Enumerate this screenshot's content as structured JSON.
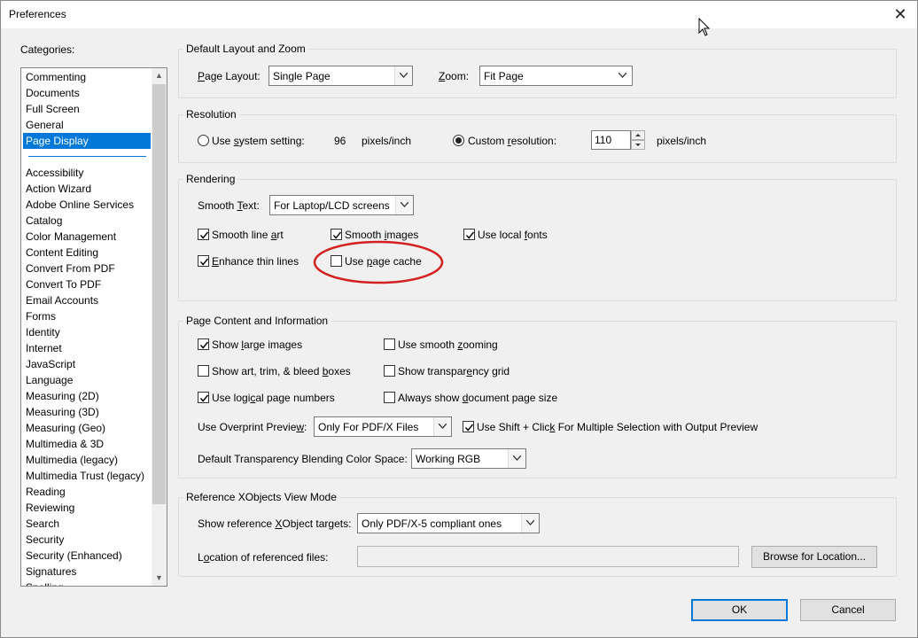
{
  "window": {
    "title": "Preferences",
    "close_glyph": "✕"
  },
  "categories": {
    "label": "Categories:",
    "top_items": [
      {
        "label": "Commenting"
      },
      {
        "label": "Documents"
      },
      {
        "label": "Full Screen"
      },
      {
        "label": "General"
      },
      {
        "label": "Page Display",
        "selected": true
      }
    ],
    "items": [
      {
        "label": "Accessibility"
      },
      {
        "label": "Action Wizard"
      },
      {
        "label": "Adobe Online Services"
      },
      {
        "label": "Catalog"
      },
      {
        "label": "Color Management"
      },
      {
        "label": "Content Editing"
      },
      {
        "label": "Convert From PDF"
      },
      {
        "label": "Convert To PDF"
      },
      {
        "label": "Email Accounts"
      },
      {
        "label": "Forms"
      },
      {
        "label": "Identity"
      },
      {
        "label": "Internet"
      },
      {
        "label": "JavaScript"
      },
      {
        "label": "Language"
      },
      {
        "label": "Measuring (2D)"
      },
      {
        "label": "Measuring (3D)"
      },
      {
        "label": "Measuring (Geo)"
      },
      {
        "label": "Multimedia & 3D"
      },
      {
        "label": "Multimedia (legacy)"
      },
      {
        "label": "Multimedia Trust (legacy)"
      },
      {
        "label": "Reading"
      },
      {
        "label": "Reviewing"
      },
      {
        "label": "Search"
      },
      {
        "label": "Security"
      },
      {
        "label": "Security (Enhanced)"
      },
      {
        "label": "Signatures"
      },
      {
        "label": "Spelling"
      }
    ]
  },
  "layout_zoom": {
    "title": "Default Layout and Zoom",
    "page_layout_label": "Page Layout:",
    "page_layout_value": "Single Page",
    "zoom_label": "Zoom:",
    "zoom_value": "Fit Page"
  },
  "resolution": {
    "title": "Resolution",
    "system_label": "Use system setting:",
    "system_value": "96",
    "system_unit": "pixels/inch",
    "custom_label": "Custom resolution:",
    "custom_value": "110",
    "custom_unit": "pixels/inch",
    "selected": "custom"
  },
  "rendering": {
    "title": "Rendering",
    "smooth_text_label": "Smooth Text:",
    "smooth_text_value": "For Laptop/LCD screens",
    "smooth_line_art": {
      "label": "Smooth line art",
      "checked": true
    },
    "smooth_images": {
      "label": "Smooth images",
      "checked": true
    },
    "use_local_fonts": {
      "label": "Use local fonts",
      "checked": true
    },
    "enhance_thin_lines": {
      "label": "Enhance thin lines",
      "checked": true
    },
    "use_page_cache": {
      "label": "Use page cache",
      "checked": false
    }
  },
  "page_content": {
    "title": "Page Content and Information",
    "show_large_images": {
      "label": "Show large images",
      "checked": true
    },
    "use_smooth_zooming": {
      "label": "Use smooth zooming",
      "checked": false
    },
    "show_art_trim": {
      "label": "Show art, trim, & bleed boxes",
      "checked": false
    },
    "show_transparency_grid": {
      "label": "Show transparency grid",
      "checked": false
    },
    "use_logical_page_numbers": {
      "label": "Use logical page numbers",
      "checked": true
    },
    "always_show_page_size": {
      "label": "Always show document page size",
      "checked": false
    },
    "overprint_label": "Use Overprint Preview:",
    "overprint_value": "Only For PDF/X Files",
    "shift_click": {
      "label": "Use Shift + Click For Multiple Selection with Output Preview",
      "checked": true
    },
    "blending_label": "Default Transparency Blending Color Space:",
    "blending_value": "Working RGB"
  },
  "xobjects": {
    "title": "Reference XObjects View Mode",
    "targets_label": "Show reference XObject targets:",
    "targets_value": "Only PDF/X-5 compliant ones",
    "location_label": "Location of referenced files:",
    "location_value": "",
    "browse_label": "Browse for Location..."
  },
  "buttons": {
    "ok": "OK",
    "cancel": "Cancel"
  },
  "colors": {
    "accent": "#0078d7",
    "highlight_circle": "#d42020"
  }
}
